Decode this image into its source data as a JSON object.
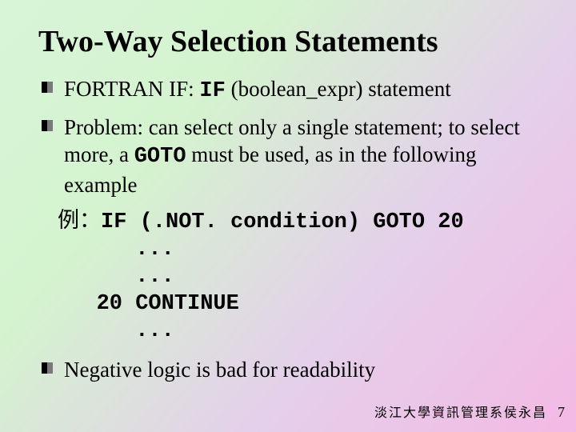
{
  "title": "Two-Way Selection Statements",
  "bullets": {
    "b1_pre": "FORTRAN IF:  ",
    "b1_code": "IF",
    "b1_post": " (boolean_expr) statement",
    "b2_pre": "Problem: can select only a single statement; to select more, a ",
    "b2_code": "GOTO",
    "b2_post": " must be used, as in the following example",
    "b3": "Negative logic is bad for readability"
  },
  "code": {
    "label": "例：",
    "l1": "IF (.NOT. condition) GOTO 20",
    "l2": "   ...",
    "l3": "   ...",
    "l4": "20 CONTINUE",
    "l5": "   ..."
  },
  "footer": "淡江大學資訊管理系侯永昌",
  "page": "7"
}
